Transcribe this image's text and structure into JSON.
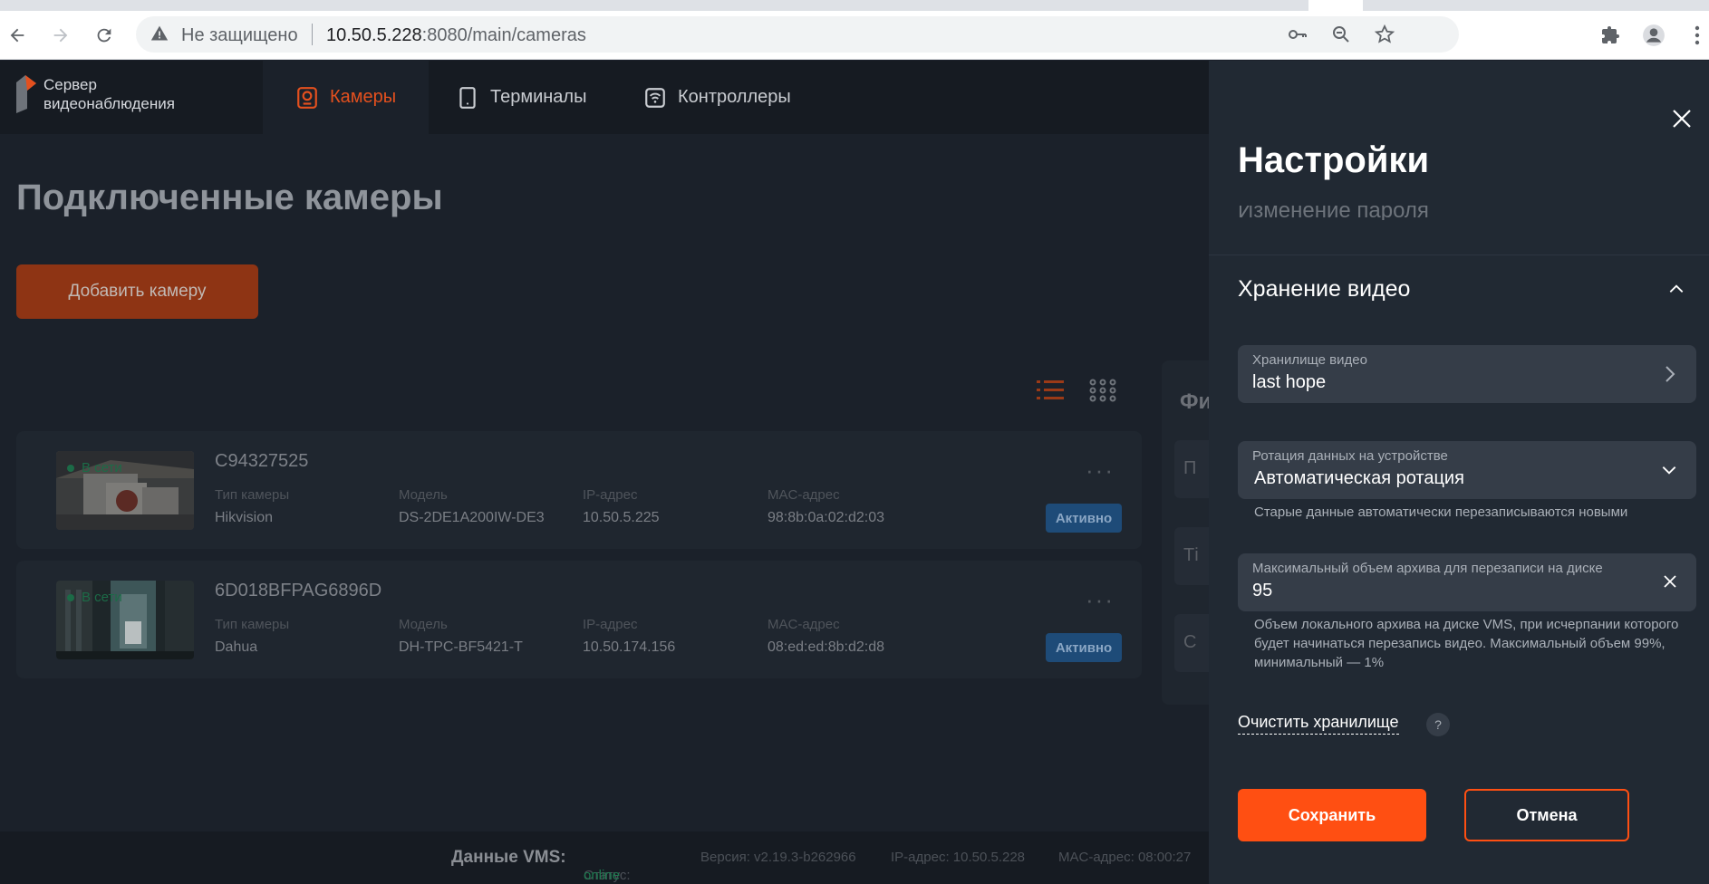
{
  "browser": {
    "security_label": "Не защищено",
    "url_host": "10.50.5.228",
    "url_rest": ":8080/main/cameras"
  },
  "app": {
    "logo_line1": "Сервер",
    "logo_line2": "видеонаблюдения",
    "nav": [
      {
        "label": "Камеры",
        "active": true
      },
      {
        "label": "Терминалы",
        "active": false
      },
      {
        "label": "Контроллеры",
        "active": false
      }
    ]
  },
  "main": {
    "title": "Подключенные камеры",
    "add_button": "Добавить камеру",
    "field_labels": {
      "type": "Тип камеры",
      "model": "Модель",
      "ip": "IP-адрес",
      "mac": "MAC-адрес"
    },
    "cameras": [
      {
        "name": "C94327525",
        "status": "В сети",
        "type": "Hikvision",
        "model": "DS-2DE1A200IW-DE3",
        "ip": "10.50.5.225",
        "mac": "98:8b:0a:02:d2:03",
        "badge": "Активно"
      },
      {
        "name": "6D018BFPAG6896D",
        "status": "В сети",
        "type": "Dahua",
        "model": "DH-TPC-BF5421-T",
        "ip": "10.50.174.156",
        "mac": "08:ed:ed:8b:d2:d8",
        "badge": "Активно"
      }
    ],
    "more": "···"
  },
  "filter": {
    "title": "Фи",
    "items": [
      "П",
      "Ті",
      "С"
    ]
  },
  "footer": {
    "title": "Данные VMS:",
    "status_label": "Статус:",
    "status_value": "online",
    "version": "Версия: v2.19.3-b262966",
    "ip": "IP-адрес: 10.50.5.228",
    "mac": "MAC-адрес: 08:00:27"
  },
  "settings": {
    "title": "Настройки",
    "prev_section": "Изменение пароля",
    "section_title": "Хранение видео",
    "storage": {
      "label": "Хранилище видео",
      "value": "last hope"
    },
    "rotation": {
      "label": "Ротация данных на устройстве",
      "value": "Автоматическая ротация",
      "hint": "Старые данные автоматически перезаписываются новыми"
    },
    "max_volume": {
      "label": "Максимальный объем архива для перезаписи на диске",
      "value": "95",
      "hint": "Объем локального архива на диске VMS, при исчерпании которого будет начинаться перезапись видео. Максимальный объем 99%, минимальный — 1%"
    },
    "clear_link": "Очистить хранилище",
    "help": "?",
    "save": "Сохранить",
    "cancel": "Отмена"
  },
  "colors": {
    "accent": "#ff4f12",
    "online": "#1c7a4f",
    "badge": "#1e4b78"
  }
}
